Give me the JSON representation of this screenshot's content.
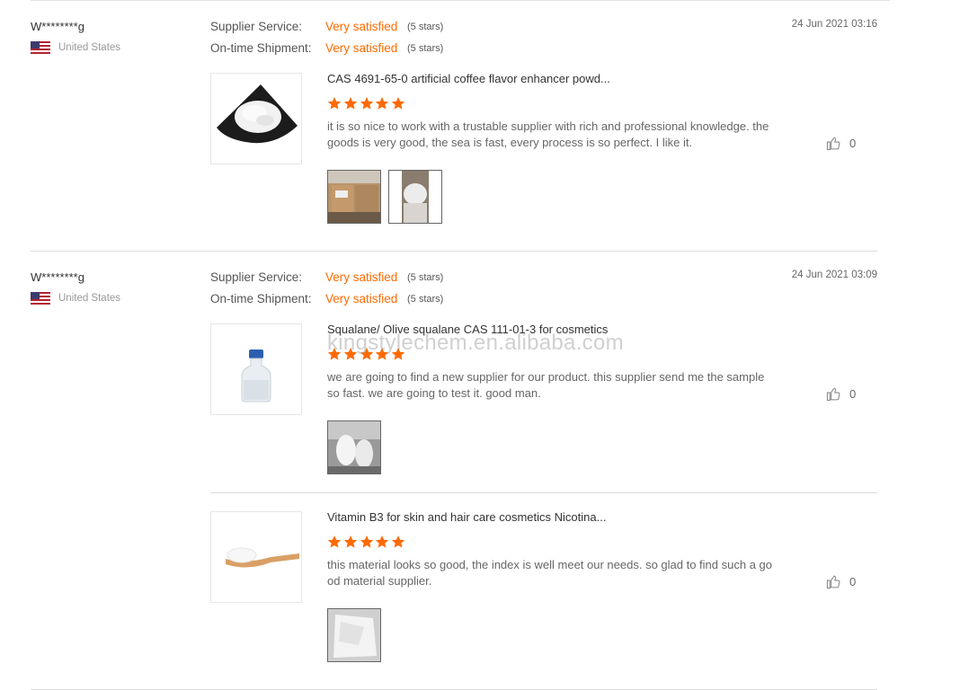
{
  "reviews": [
    {
      "user": "W********g",
      "country": "United States",
      "date": "24 Jun 2021 03:16",
      "ratings": [
        {
          "label": "Supplier Service:",
          "value": "Very satisfied",
          "stars": "(5 stars)"
        },
        {
          "label": "On-time Shipment:",
          "value": "Very satisfied",
          "stars": "(5 stars)"
        }
      ],
      "items": [
        {
          "product": "CAS 4691-65-0 artificial coffee flavor enhancer powd...",
          "rating": 5,
          "comment": "it is so nice to work with a trustable supplier with rich and professional knowledge. the goods is very good, the sea is fast, every process is so perfect. I like it.",
          "likes": "0",
          "photo_count": 2
        }
      ]
    },
    {
      "user": "W********g",
      "country": "United States",
      "date": "24 Jun 2021 03:09",
      "ratings": [
        {
          "label": "Supplier Service:",
          "value": "Very satisfied",
          "stars": "(5 stars)"
        },
        {
          "label": "On-time Shipment:",
          "value": "Very satisfied",
          "stars": "(5 stars)"
        }
      ],
      "items": [
        {
          "product": "Squalane/ Olive squalane CAS 111-01-3 for cosmetics",
          "rating": 5,
          "comment": "we are going to find a new supplier for our product. this supplier send me the sample so fast. we are going to test it. good man.",
          "likes": "0",
          "photo_count": 1
        },
        {
          "product": "Vitamin B3 for skin and hair care cosmetics Nicotina...",
          "rating": 5,
          "comment": "this material looks so good, the index is well meet our needs. so glad to find such a good material supplier.",
          "likes": "0",
          "photo_count": 1
        }
      ]
    }
  ],
  "watermark": "kingstylechem.en.alibaba.com",
  "colors": {
    "accent": "#ff6a00",
    "star": "#ff6a00",
    "divider": "#dcdcdc"
  },
  "icons": {
    "like": "thumbs-up-icon",
    "flag": "us-flag-icon",
    "star": "star-icon"
  }
}
